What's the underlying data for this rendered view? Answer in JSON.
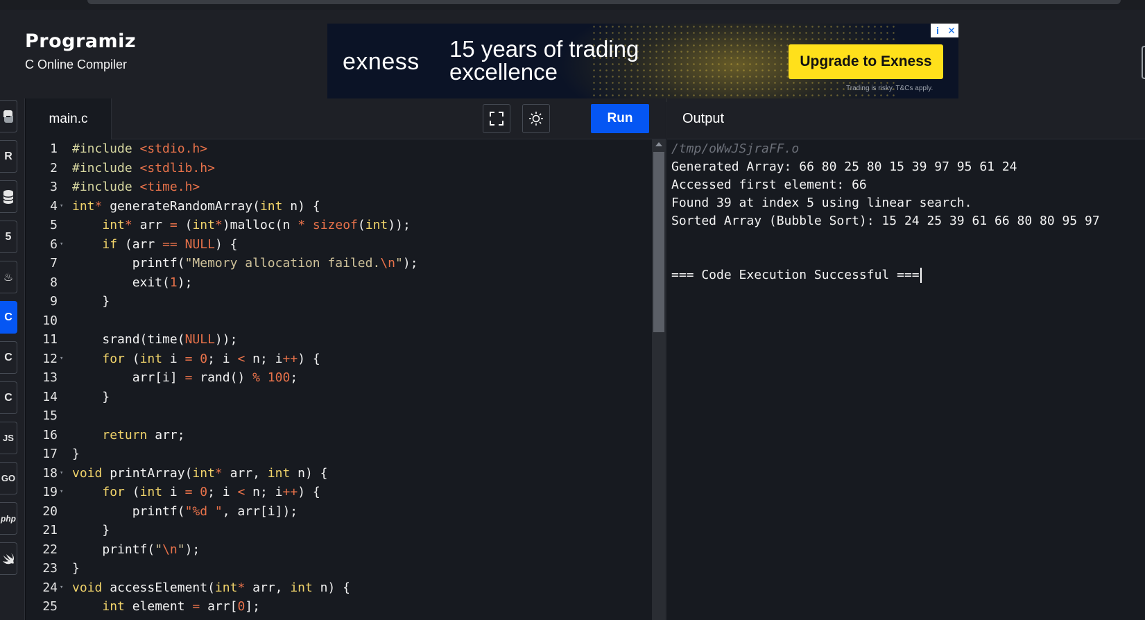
{
  "brand": {
    "logo": "Programiz",
    "subtitle": "C Online Compiler"
  },
  "ad": {
    "brand": "exness",
    "headline": "15 years of trading excellence",
    "cta": "Upgrade to Exness",
    "disclaimer": "Trading is risky. T&Cs apply.",
    "info_icon": "i",
    "close_icon": "✕"
  },
  "sidebar": {
    "items": [
      {
        "name": "python",
        "glyph": ""
      },
      {
        "name": "r",
        "glyph": "R"
      },
      {
        "name": "sql",
        "glyph": ""
      },
      {
        "name": "html",
        "glyph": "5"
      },
      {
        "name": "java",
        "glyph": "♨"
      },
      {
        "name": "c",
        "glyph": "C"
      },
      {
        "name": "cpp",
        "glyph": "C"
      },
      {
        "name": "csharp",
        "glyph": "C"
      },
      {
        "name": "js",
        "glyph": "JS"
      },
      {
        "name": "go",
        "glyph": "GO"
      },
      {
        "name": "php",
        "glyph": "php"
      },
      {
        "name": "swift",
        "glyph": ""
      }
    ]
  },
  "editor": {
    "file_tab": "main.c",
    "run_label": "Run",
    "lines": [
      {
        "n": "1",
        "fold": "",
        "t": [
          [
            "#include ",
            "#d7d7a0"
          ],
          [
            "<stdio.h>",
            "#e8724a"
          ]
        ]
      },
      {
        "n": "2",
        "fold": "",
        "t": [
          [
            "#include ",
            "#d7d7a0"
          ],
          [
            "<stdlib.h>",
            "#e8724a"
          ]
        ]
      },
      {
        "n": "3",
        "fold": "",
        "t": [
          [
            "#include ",
            "#d7d7a0"
          ],
          [
            "<time.h>",
            "#e8724a"
          ]
        ]
      },
      {
        "n": "4",
        "fold": "▾",
        "t": [
          [
            "int",
            "#f0d36a"
          ],
          [
            "* ",
            "#e8724a"
          ],
          [
            "generateRandomArray(",
            "#f2f2f2"
          ],
          [
            "int",
            "#f0d36a"
          ],
          [
            " n) {",
            "#f2f2f2"
          ]
        ]
      },
      {
        "n": "5",
        "fold": "",
        "t": [
          [
            "    ",
            "#f2f2f2"
          ],
          [
            "int",
            "#f0d36a"
          ],
          [
            "* ",
            "#e8724a"
          ],
          [
            "arr ",
            "#f2f2f2"
          ],
          [
            "=",
            "#e8724a"
          ],
          [
            " (",
            "#f2f2f2"
          ],
          [
            "int",
            "#f0d36a"
          ],
          [
            "*",
            "#e8724a"
          ],
          [
            ")malloc(n ",
            "#f2f2f2"
          ],
          [
            "*",
            "#e8724a"
          ],
          [
            " ",
            "#f2f2f2"
          ],
          [
            "sizeof",
            "#e8724a"
          ],
          [
            "(",
            "#f2f2f2"
          ],
          [
            "int",
            "#f0d36a"
          ],
          [
            "));",
            "#f2f2f2"
          ]
        ]
      },
      {
        "n": "6",
        "fold": "▾",
        "t": [
          [
            "    ",
            "#f2f2f2"
          ],
          [
            "if",
            "#f0d36a"
          ],
          [
            " (arr ",
            "#f2f2f2"
          ],
          [
            "==",
            "#e8724a"
          ],
          [
            " ",
            "#f2f2f2"
          ],
          [
            "NULL",
            "#e8724a"
          ],
          [
            ") {",
            "#f2f2f2"
          ]
        ]
      },
      {
        "n": "7",
        "fold": "",
        "t": [
          [
            "        printf(",
            "#f2f2f2"
          ],
          [
            "\"Memory allocation failed.",
            "#cfc29a"
          ],
          [
            "\\n",
            "#e8724a"
          ],
          [
            "\"",
            "#cfc29a"
          ],
          [
            ");",
            "#f2f2f2"
          ]
        ]
      },
      {
        "n": "8",
        "fold": "",
        "t": [
          [
            "        exit(",
            "#f2f2f2"
          ],
          [
            "1",
            "#e8724a"
          ],
          [
            ");",
            "#f2f2f2"
          ]
        ]
      },
      {
        "n": "9",
        "fold": "",
        "t": [
          [
            "    }",
            "#f2f2f2"
          ]
        ]
      },
      {
        "n": "10",
        "fold": "",
        "t": []
      },
      {
        "n": "11",
        "fold": "",
        "t": [
          [
            "    srand(time(",
            "#f2f2f2"
          ],
          [
            "NULL",
            "#e8724a"
          ],
          [
            "));",
            "#f2f2f2"
          ]
        ]
      },
      {
        "n": "12",
        "fold": "▾",
        "t": [
          [
            "    ",
            "#f2f2f2"
          ],
          [
            "for",
            "#f0d36a"
          ],
          [
            " (",
            "#f2f2f2"
          ],
          [
            "int",
            "#f0d36a"
          ],
          [
            " i ",
            "#f2f2f2"
          ],
          [
            "=",
            "#e8724a"
          ],
          [
            " ",
            "#f2f2f2"
          ],
          [
            "0",
            "#e8724a"
          ],
          [
            "; i ",
            "#f2f2f2"
          ],
          [
            "<",
            "#e8724a"
          ],
          [
            " n; i",
            "#f2f2f2"
          ],
          [
            "++",
            "#e8724a"
          ],
          [
            ") {",
            "#f2f2f2"
          ]
        ]
      },
      {
        "n": "13",
        "fold": "",
        "t": [
          [
            "        arr[i] ",
            "#f2f2f2"
          ],
          [
            "=",
            "#e8724a"
          ],
          [
            " rand() ",
            "#f2f2f2"
          ],
          [
            "%",
            "#e8724a"
          ],
          [
            " ",
            "#f2f2f2"
          ],
          [
            "100",
            "#e8724a"
          ],
          [
            ";",
            "#f2f2f2"
          ]
        ]
      },
      {
        "n": "14",
        "fold": "",
        "t": [
          [
            "    }",
            "#f2f2f2"
          ]
        ]
      },
      {
        "n": "15",
        "fold": "",
        "t": []
      },
      {
        "n": "16",
        "fold": "",
        "t": [
          [
            "    ",
            "#f2f2f2"
          ],
          [
            "return",
            "#f0d36a"
          ],
          [
            " arr;",
            "#f2f2f2"
          ]
        ]
      },
      {
        "n": "17",
        "fold": "",
        "t": [
          [
            "}",
            "#f2f2f2"
          ]
        ]
      },
      {
        "n": "18",
        "fold": "▾",
        "t": [
          [
            "void",
            "#f0d36a"
          ],
          [
            " printArray(",
            "#f2f2f2"
          ],
          [
            "int",
            "#f0d36a"
          ],
          [
            "*",
            "#e8724a"
          ],
          [
            " arr, ",
            "#f2f2f2"
          ],
          [
            "int",
            "#f0d36a"
          ],
          [
            " n) {",
            "#f2f2f2"
          ]
        ]
      },
      {
        "n": "19",
        "fold": "▾",
        "t": [
          [
            "    ",
            "#f2f2f2"
          ],
          [
            "for",
            "#f0d36a"
          ],
          [
            " (",
            "#f2f2f2"
          ],
          [
            "int",
            "#f0d36a"
          ],
          [
            " i ",
            "#f2f2f2"
          ],
          [
            "=",
            "#e8724a"
          ],
          [
            " ",
            "#f2f2f2"
          ],
          [
            "0",
            "#e8724a"
          ],
          [
            "; i ",
            "#f2f2f2"
          ],
          [
            "<",
            "#e8724a"
          ],
          [
            " n; i",
            "#f2f2f2"
          ],
          [
            "++",
            "#e8724a"
          ],
          [
            ") {",
            "#f2f2f2"
          ]
        ]
      },
      {
        "n": "20",
        "fold": "",
        "t": [
          [
            "        printf(",
            "#f2f2f2"
          ],
          [
            "\"%d \"",
            "#e8724a"
          ],
          [
            ", arr[i]);",
            "#f2f2f2"
          ]
        ]
      },
      {
        "n": "21",
        "fold": "",
        "t": [
          [
            "    }",
            "#f2f2f2"
          ]
        ]
      },
      {
        "n": "22",
        "fold": "",
        "t": [
          [
            "    printf(",
            "#f2f2f2"
          ],
          [
            "\"",
            "#cfc29a"
          ],
          [
            "\\n",
            "#e8724a"
          ],
          [
            "\"",
            "#cfc29a"
          ],
          [
            ");",
            "#f2f2f2"
          ]
        ]
      },
      {
        "n": "23",
        "fold": "",
        "t": [
          [
            "}",
            "#f2f2f2"
          ]
        ]
      },
      {
        "n": "24",
        "fold": "▾",
        "t": [
          [
            "void",
            "#f0d36a"
          ],
          [
            " accessElement(",
            "#f2f2f2"
          ],
          [
            "int",
            "#f0d36a"
          ],
          [
            "*",
            "#e8724a"
          ],
          [
            " arr, ",
            "#f2f2f2"
          ],
          [
            "int",
            "#f0d36a"
          ],
          [
            " n) {",
            "#f2f2f2"
          ]
        ]
      },
      {
        "n": "25",
        "fold": "",
        "t": [
          [
            "    ",
            "#f2f2f2"
          ],
          [
            "int",
            "#f0d36a"
          ],
          [
            " element ",
            "#f2f2f2"
          ],
          [
            "=",
            "#e8724a"
          ],
          [
            " arr[",
            "#f2f2f2"
          ],
          [
            "0",
            "#e8724a"
          ],
          [
            "];",
            "#f2f2f2"
          ]
        ]
      }
    ]
  },
  "output": {
    "title": "Output",
    "path": "/tmp/oWwJSjraFF.o",
    "line1": "Generated Array: 66 80 25 80 15 39 97 95 61 24",
    "line2": "Accessed first element: 66",
    "line3": "Found 39 at index 5 using linear search.",
    "line4": "Sorted Array (Bubble Sort): 15 24 25 39 61 66 80 80 95 97",
    "success": "=== Code Execution Successful ==="
  }
}
